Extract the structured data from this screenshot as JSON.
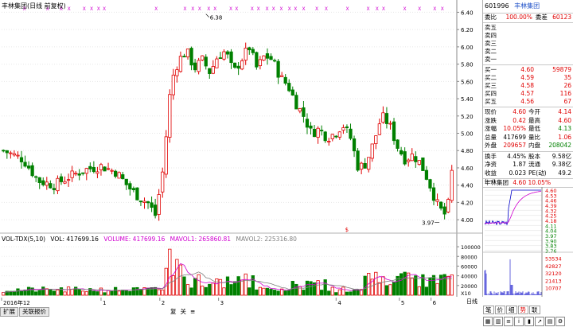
{
  "header": {
    "title": "丰林集团(日线 前复权)",
    "vol_title": "VOL-TDX(5,10)",
    "vol_value": "VOL: 417699.16",
    "volume_value": "VOLUME: 417699.16",
    "mavol1": "MAVOL1: 265860.81",
    "mavol2": "MAVOL2: 225316.80",
    "high_label": "6.38",
    "low_label": "3.97",
    "x_marker": "X"
  },
  "price_axis": [
    "6.40",
    "6.20",
    "6.00",
    "5.80",
    "5.60",
    "5.40",
    "5.20",
    "5.00",
    "4.80",
    "4.60",
    "4.40",
    "4.20",
    "4.00"
  ],
  "volume_axis": [
    "100000",
    "80000",
    "60000",
    "40000",
    "20000",
    "X10"
  ],
  "date_axis": [
    "2016年12",
    "1",
    "2",
    "3",
    "4",
    "5",
    "6"
  ],
  "stock": {
    "code": "601996",
    "name": "丰林集团",
    "weibi_label": "委比",
    "weibi": "100.00%",
    "weicha_label": "委差",
    "weicha": "60123",
    "sells": [
      {
        "label": "卖五",
        "price": "",
        "vol": ""
      },
      {
        "label": "卖四",
        "price": "",
        "vol": ""
      },
      {
        "label": "卖三",
        "price": "",
        "vol": ""
      },
      {
        "label": "卖二",
        "price": "",
        "vol": ""
      },
      {
        "label": "卖一",
        "price": "",
        "vol": ""
      }
    ],
    "buys": [
      {
        "label": "买一",
        "price": "4.60",
        "vol": "59879"
      },
      {
        "label": "买二",
        "price": "4.59",
        "vol": "35"
      },
      {
        "label": "买三",
        "price": "4.58",
        "vol": "26"
      },
      {
        "label": "买四",
        "price": "4.57",
        "vol": "116"
      },
      {
        "label": "买五",
        "price": "4.56",
        "vol": "67"
      }
    ],
    "quote": [
      {
        "a": "现价",
        "b": "4.60",
        "c": "今开",
        "d": "4.14"
      },
      {
        "a": "涨跌",
        "b": "0.42",
        "c": "最高",
        "d": "4.60"
      },
      {
        "a": "涨幅",
        "b": "10.05%",
        "c": "最低",
        "d": "4.13"
      },
      {
        "a": "总量",
        "b": "417699",
        "c": "量比",
        "d": "1.06"
      },
      {
        "a": "外盘",
        "b": "209657",
        "c": "内盘",
        "d": "208042"
      }
    ],
    "fundamentals": [
      {
        "a": "换手",
        "b": "4.45%",
        "c": "股本",
        "d": "9.58亿"
      },
      {
        "a": "净资",
        "b": "1.87",
        "c": "流通",
        "d": "9.38亿"
      },
      {
        "a": "收益(一)",
        "b": "0.023",
        "c": "PE(动)",
        "d": "49.2"
      }
    ],
    "mini_title_name": "丰林集团",
    "mini_title_value": "4.60 10.05%",
    "mini_price_axis": [
      "4.60",
      "4.53",
      "4.46",
      "4.39",
      "4.32",
      "4.25",
      "4.18",
      "4.11",
      "4.04",
      "3.97",
      "3.90",
      "3.83",
      "3.76"
    ],
    "mini_vol_axis": [
      "53534",
      "42827",
      "32120",
      "21413",
      "10707"
    ]
  },
  "tabs": [
    "扩展",
    "关联报价"
  ],
  "toolbar": [
    "复",
    "关",
    "≡",
    "日线"
  ],
  "right_tabs": [
    "笔",
    "价",
    "细",
    "势",
    "联"
  ]
}
